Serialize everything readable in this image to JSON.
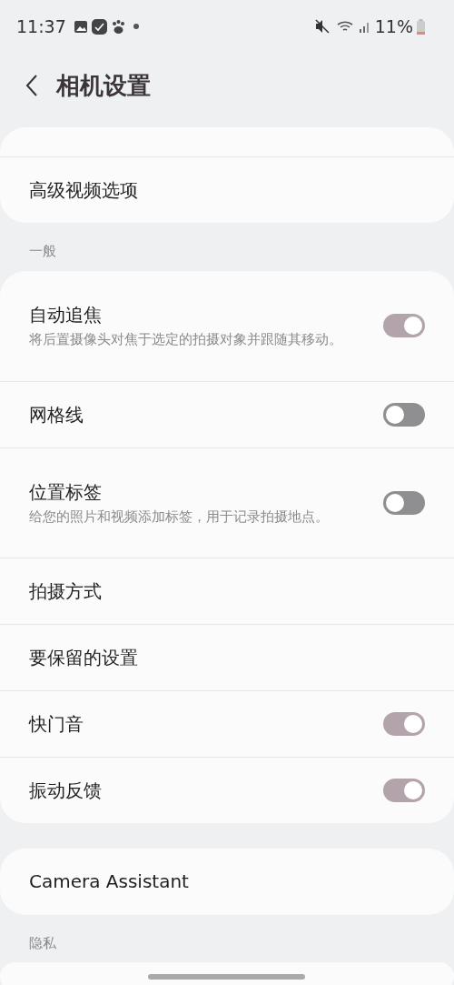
{
  "status_bar": {
    "time": "11:37",
    "battery": "11%"
  },
  "header": {
    "title": "相机设置"
  },
  "sections": [
    {
      "items": [
        {
          "kind": "clipped"
        },
        {
          "kind": "link",
          "label": "高级视频选项"
        }
      ]
    },
    {
      "heading": "一般",
      "items": [
        {
          "kind": "toggle",
          "label": "自动追焦",
          "description": "将后置摄像头对焦于选定的拍摄对象并跟随其移动。",
          "on": true
        },
        {
          "kind": "toggle",
          "label": "网格线",
          "on": false
        },
        {
          "kind": "toggle",
          "label": "位置标签",
          "description": "给您的照片和视频添加标签，用于记录拍摄地点。",
          "on": false
        },
        {
          "kind": "link",
          "label": "拍摄方式"
        },
        {
          "kind": "link",
          "label": "要保留的设置"
        },
        {
          "kind": "toggle",
          "label": "快门音",
          "on": true
        },
        {
          "kind": "toggle",
          "label": "振动反馈",
          "on": true
        }
      ]
    },
    {
      "items": [
        {
          "kind": "link",
          "label": "Camera Assistant"
        }
      ]
    },
    {
      "heading": "隐私",
      "items": [
        {
          "kind": "clipped"
        }
      ]
    }
  ]
}
